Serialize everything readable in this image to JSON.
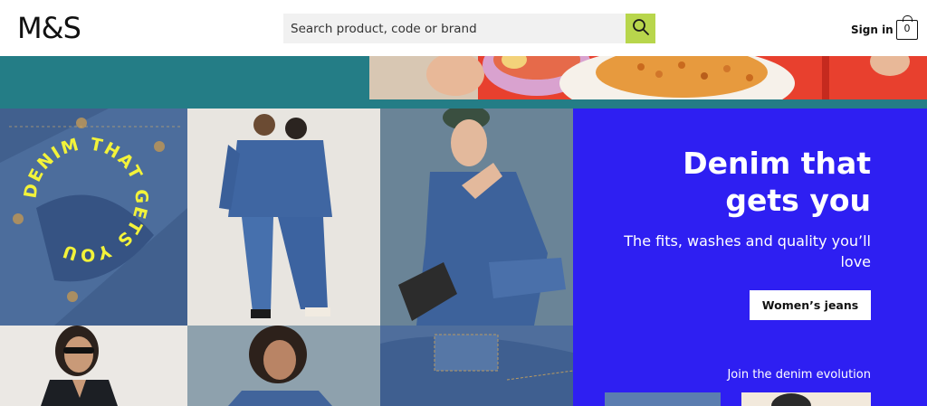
{
  "header": {
    "logo": "M&S",
    "search_placeholder": "Search product, code or brand",
    "sign_in": "Sign in",
    "bag_count": "0"
  },
  "colors": {
    "search_button": "#b8d64c",
    "banner_teal": "#247d86",
    "promo_blue": "#2e1ff2"
  },
  "promo": {
    "title": "Denim that gets you",
    "subtitle": "The fits, washes and quality you’ll love",
    "button": "Women’s jeans",
    "join": "Join the denim evolution"
  },
  "tiles": {
    "badge_text": "DENIM THAT GETS YOU"
  },
  "icons": [
    "search-icon",
    "shopping-bag-icon"
  ]
}
